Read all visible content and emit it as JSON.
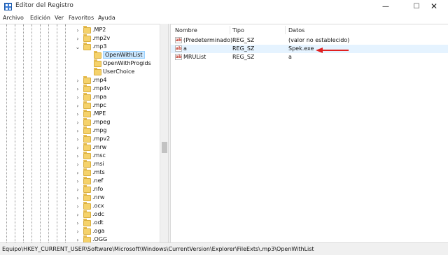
{
  "window": {
    "title": "Editor del Registro",
    "minimize": "—",
    "maximize": "☐",
    "close": "✕",
    "app_icon": "registry-editor-icon"
  },
  "menu": [
    "Archivo",
    "Edición",
    "Ver",
    "Favoritos",
    "Ayuda"
  ],
  "tree": {
    "items": [
      {
        "label": ".MP2",
        "chevron": "›"
      },
      {
        "label": ".mp2v",
        "chevron": "›"
      },
      {
        "label": ".mp3",
        "chevron": "⌄"
      },
      {
        "label": "OpenWithList",
        "chevron": ""
      },
      {
        "label": "OpenWithProgids",
        "chevron": ""
      },
      {
        "label": "UserChoice",
        "chevron": ""
      },
      {
        "label": ".mp4",
        "chevron": "›"
      },
      {
        "label": ".mp4v",
        "chevron": "›"
      },
      {
        "label": ".mpa",
        "chevron": "›"
      },
      {
        "label": ".mpc",
        "chevron": "›"
      },
      {
        "label": ".MPE",
        "chevron": "›"
      },
      {
        "label": ".mpeg",
        "chevron": "›"
      },
      {
        "label": ".mpg",
        "chevron": "›"
      },
      {
        "label": ".mpv2",
        "chevron": "›"
      },
      {
        "label": ".mrw",
        "chevron": "›"
      },
      {
        "label": ".msc",
        "chevron": "›"
      },
      {
        "label": ".msi",
        "chevron": "›"
      },
      {
        "label": ".mts",
        "chevron": "›"
      },
      {
        "label": ".nef",
        "chevron": "›"
      },
      {
        "label": ".nfo",
        "chevron": "›"
      },
      {
        "label": ".nrw",
        "chevron": "›"
      },
      {
        "label": ".ocx",
        "chevron": "›"
      },
      {
        "label": ".odc",
        "chevron": "›"
      },
      {
        "label": ".odt",
        "chevron": "›"
      },
      {
        "label": ".oga",
        "chevron": "›"
      },
      {
        "label": ".OGG",
        "chevron": "›"
      }
    ],
    "selected": "OpenWithList"
  },
  "list": {
    "columns": [
      "Nombre",
      "Tipo",
      "Datos"
    ],
    "rows": [
      {
        "name": "(Predeterminado)",
        "type": "REG_SZ",
        "data": "(valor no establecido)"
      },
      {
        "name": "a",
        "type": "REG_SZ",
        "data": "Spek.exe"
      },
      {
        "name": "MRUList",
        "type": "REG_SZ",
        "data": "a"
      }
    ],
    "icon_text": "ab",
    "highlighted_row": "a"
  },
  "annotation": {
    "arrow_color": "#e02020"
  },
  "status": {
    "path": "Equipo\\HKEY_CURRENT_USER\\Software\\Microsoft\\Windows\\CurrentVersion\\Explorer\\FileExts\\.mp3\\OpenWithList"
  }
}
